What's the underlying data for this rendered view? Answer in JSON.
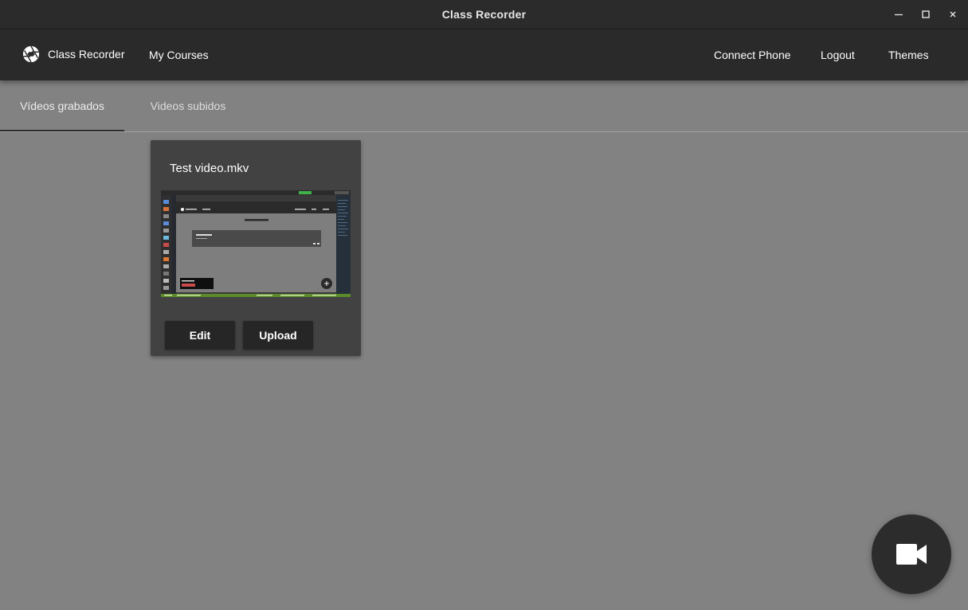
{
  "window": {
    "title": "Class Recorder",
    "controls": [
      "minimize-icon",
      "maximize-icon",
      "close-icon"
    ]
  },
  "appbar": {
    "brand_label": "Class Recorder",
    "brand_icon": "aperture-icon",
    "my_courses": "My Courses",
    "connect_phone": "Connect Phone",
    "logout": "Logout",
    "themes": "Themes"
  },
  "tabs": [
    {
      "label": "Vídeos grabados",
      "active": true
    },
    {
      "label": "Videos subidos",
      "active": false
    }
  ],
  "videos": [
    {
      "title": "Test video.mkv",
      "edit_label": "Edit",
      "upload_label": "Upload",
      "thumbnail": {
        "app_title": "Class Recorder",
        "page_heading": "My Classes",
        "course_name": "Test Course"
      }
    }
  ],
  "fab": {
    "icon": "videocam-icon"
  },
  "colors": {
    "background": "#828282",
    "appbar": "#2a2a2a",
    "card": "#424242",
    "button": "#262626",
    "fab": "#2c2c2c"
  }
}
